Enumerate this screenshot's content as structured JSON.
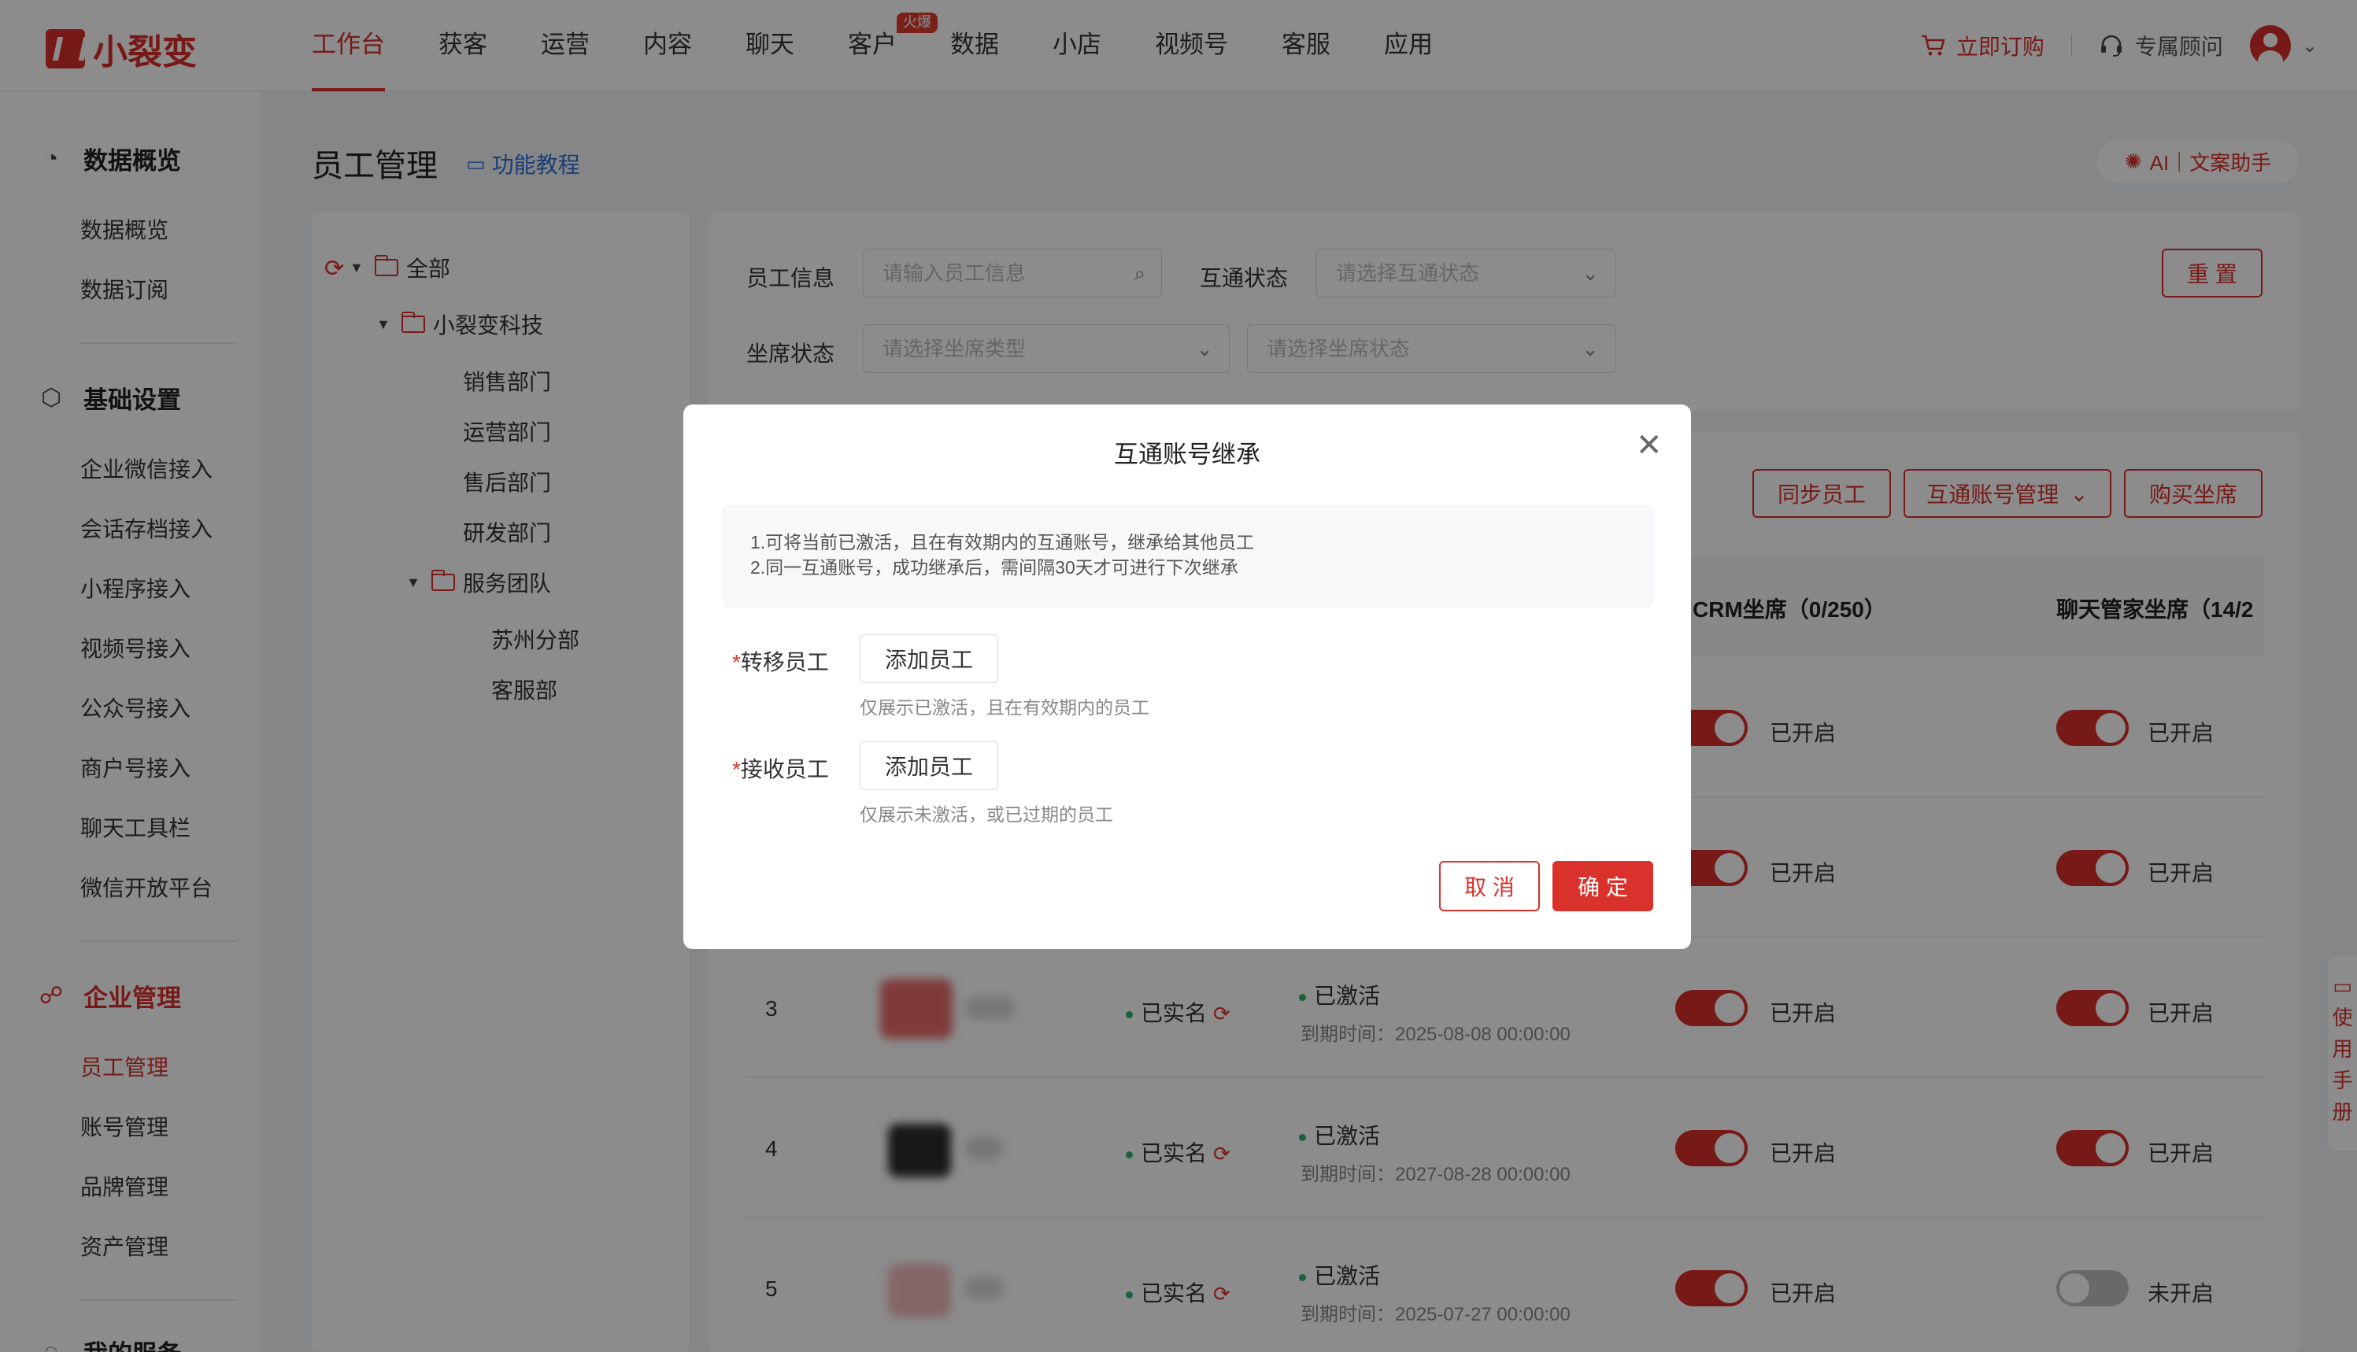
{
  "app": {
    "logo_text": "小裂变"
  },
  "nav": {
    "items": [
      "工作台",
      "获客",
      "运营",
      "内容",
      "聊天",
      "客户",
      "数据",
      "小店",
      "视频号",
      "客服",
      "应用"
    ],
    "hot_badge": "火爆"
  },
  "topright": {
    "buy": "立即订购",
    "advisor": "专属顾问"
  },
  "sidebar": {
    "g1": "数据概览",
    "g1_items": [
      "数据概览",
      "数据订阅"
    ],
    "g2": "基础设置",
    "g2_items": [
      "企业微信接入",
      "会话存档接入",
      "小程序接入",
      "视频号接入",
      "公众号接入",
      "商户号接入",
      "聊天工具栏",
      "微信开放平台"
    ],
    "g3": "企业管理",
    "g3_items": [
      "员工管理",
      "账号管理",
      "品牌管理",
      "资产管理"
    ],
    "g4": "我的服务"
  },
  "page": {
    "title": "员工管理",
    "tutorial": "功能教程",
    "ai": "AI｜文案助手"
  },
  "tree": {
    "all": "全部",
    "company": "小裂变科技",
    "depts": [
      "销售部门",
      "运营部门",
      "售后部门",
      "研发部门"
    ],
    "team": "服务团队",
    "team_children": [
      "苏州分部",
      "客服部"
    ]
  },
  "filters": {
    "info_label": "员工信息",
    "info_placeholder": "请输入员工信息",
    "status_label": "互通状态",
    "status_placeholder": "请选择互通状态",
    "seat_label": "坐席状态",
    "seat_type_placeholder": "请选择坐席类型",
    "seat_status_placeholder": "请选择坐席状态",
    "reset": "重 置"
  },
  "actions": {
    "sync": "同步员工",
    "manage": "互通账号管理",
    "buy_seat": "购买坐席"
  },
  "table": {
    "headers": {
      "crm": "CRM坐席（0/250）",
      "chat": "聊天管家坐席（14/2"
    },
    "rows": [
      {
        "no": "",
        "realname": "",
        "status": "",
        "expire": "",
        "crm": "已开启",
        "chat": "已开启"
      },
      {
        "no": "",
        "realname": "",
        "status": "",
        "expire": "",
        "crm": "已开启",
        "chat": "已开启"
      },
      {
        "no": "3",
        "realname": "已实名",
        "status": "已激活",
        "expire": "到期时间：2025-08-08 00:00:00",
        "crm": "已开启",
        "chat": "已开启"
      },
      {
        "no": "4",
        "realname": "已实名",
        "status": "已激活",
        "expire": "到期时间：2027-08-28 00:00:00",
        "crm": "已开启",
        "chat": "已开启"
      },
      {
        "no": "5",
        "realname": "已实名",
        "status": "已激活",
        "expire": "到期时间：2025-07-27 00:00:00",
        "crm": "已开启",
        "chat": "未开启"
      }
    ]
  },
  "side_float": [
    "使",
    "用",
    "手",
    "册"
  ],
  "modal": {
    "title": "互通账号继承",
    "note1": "1.可将当前已激活，且在有效期内的互通账号，继承给其他员工",
    "note2": "2.同一互通账号，成功继承后，需间隔30天才可进行下次继承",
    "required_mark": "*",
    "transfer_label": "转移员工",
    "transfer_btn": "添加员工",
    "transfer_hint": "仅展示已激活，且在有效期内的员工",
    "receive_label": "接收员工",
    "receive_btn": "添加员工",
    "receive_hint": "仅展示未激活，或已过期的员工",
    "cancel": "取 消",
    "ok": "确 定"
  },
  "colors": {
    "brand": "#d9312b",
    "success": "#2fb36d",
    "link": "#2f6fd6"
  }
}
